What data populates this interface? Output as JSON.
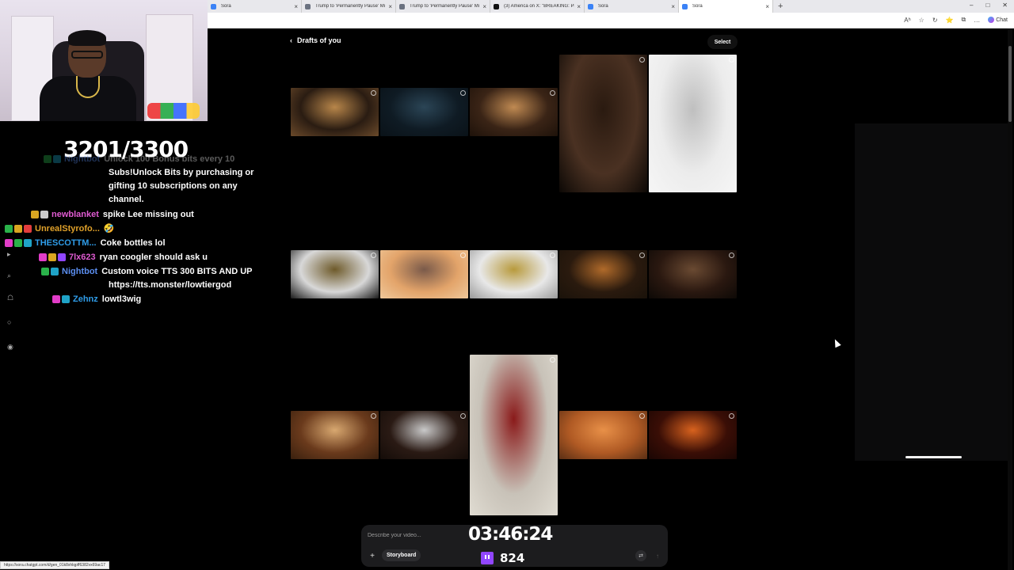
{
  "browser": {
    "tabs": [
      {
        "title": "Sora",
        "fav": "#3b82f6",
        "active": false
      },
      {
        "title": "Trump to 'Permanently Pause' Mi",
        "fav": "#6b7280",
        "active": false
      },
      {
        "title": "Trump to 'Permanently Pause' Mi",
        "fav": "#6b7280",
        "active": false
      },
      {
        "title": "(3) America on X: \"BREAKING: Pre",
        "fav": "#111111",
        "active": false
      },
      {
        "title": "Sora",
        "fav": "#3b82f6",
        "active": false
      },
      {
        "title": "Sora",
        "fav": "#3b82f6",
        "active": true
      }
    ],
    "new_tab_icon": "+",
    "window_controls": [
      "–",
      "□",
      "✕"
    ],
    "toolbar_icons": [
      "Aʰ",
      "☆",
      "↻",
      "⭐",
      "⧉",
      "…"
    ],
    "copilot_label": "Chat",
    "status_url": "https://sora.chatgpt.com/d/gen_01k8xhlqpff6382vx69ac17"
  },
  "stream": {
    "sub_counter": "3201/3300",
    "timer": "03:46:24",
    "viewers": "824"
  },
  "chat": {
    "messages": [
      {
        "user": "Nightbot",
        "color": "#5b8ef0",
        "badges": [
          "#2ab24a",
          "#1fa3c7"
        ],
        "lines": [
          "Unlock 100 Bonus bits every 10",
          "Subs!Unlock Bits by purchasing or",
          "gifting 10 subscriptions on any",
          "channel."
        ]
      },
      {
        "user": "newblanket",
        "color": "#e05bd2",
        "badges": [
          "#d9a621",
          "#cccccc"
        ],
        "lines": [
          "spike Lee missing out"
        ]
      },
      {
        "user": "UnrealStyrofo...",
        "color": "#e0a12a",
        "badges": [
          "#2ab24a",
          "#d9a621",
          "#e23d3d"
        ],
        "lines": [
          "🤣"
        ]
      },
      {
        "user": "THESCOTTM...",
        "color": "#2f9ce8",
        "badges": [
          "#e23dc8",
          "#2ab24a",
          "#1fa3c7"
        ],
        "lines": [
          "Coke bottles lol"
        ]
      },
      {
        "user": "7lx623",
        "color": "#e05bd2",
        "badges": [
          "#e23dc8",
          "#d9a621",
          "#9146ff"
        ],
        "lines": [
          "ryan coogler should ask u"
        ]
      },
      {
        "user": "Nightbot",
        "color": "#5b8ef0",
        "badges": [
          "#2ab24a",
          "#1fa3c7"
        ],
        "lines": [
          "Custom voice TTS 300 BITS AND UP",
          "https://tts.monster/lowtiergod"
        ]
      },
      {
        "user": "Zehnz",
        "color": "#2f9ce8",
        "badges": [
          "#e23dc8",
          "#1fa3c7"
        ],
        "lines": [
          "lowtl3wig"
        ]
      }
    ]
  },
  "sora": {
    "back_label": "Drafts of you",
    "select_label": "Select",
    "thumbnails": [
      {
        "name": "man-smiling-city-lights",
        "colors": [
          "#2a1c12",
          "#b8864a",
          "#6b4a2a"
        ]
      },
      {
        "name": "hand-closeup-blue",
        "colors": [
          "#0f1b24",
          "#2b4556",
          "#0a1218"
        ]
      },
      {
        "name": "dinner-toast-couple",
        "colors": [
          "#3a2416",
          "#c08a52",
          "#1e120a"
        ]
      },
      {
        "name": "smiling-man-gold-chain",
        "colors": [
          "#4a3122",
          "#2a1a10",
          "#0c0805"
        ]
      },
      {
        "name": "glass-pitcher",
        "colors": [
          "#ececec",
          "#bfbfbf",
          "#f6f6f6"
        ]
      },
      {
        "name": "man-gold-robe-mirror",
        "colors": [
          "#d8d8d8",
          "#6e5a2a",
          "#1b1b1b"
        ]
      },
      {
        "name": "couple-sunset",
        "colors": [
          "#e3a46a",
          "#7a5a4a",
          "#f0c89a"
        ]
      },
      {
        "name": "gold-robe-hallway",
        "colors": [
          "#e8e8e8",
          "#b89a3c",
          "#9a9a9a"
        ]
      },
      {
        "name": "woman-bokeh-night",
        "colors": [
          "#2a1a0e",
          "#b06a2a",
          "#1a120a"
        ]
      },
      {
        "name": "man-talking-night",
        "colors": [
          "#2a1810",
          "#6a4a32",
          "#0d0906"
        ]
      },
      {
        "name": "family-dinner-table",
        "colors": [
          "#6a3a1c",
          "#d8a870",
          "#3a200e"
        ]
      },
      {
        "name": "grill-teeth-closeup",
        "colors": [
          "#2a1a14",
          "#c9c9c9",
          "#140c08"
        ]
      },
      {
        "name": "caesar-laurel-wreath",
        "colors": [
          "#c8c2b8",
          "#8a1a1a",
          "#e0dcd2"
        ]
      },
      {
        "name": "robot-arm-orange",
        "colors": [
          "#b05a24",
          "#e89048",
          "#5a2e14"
        ]
      },
      {
        "name": "fire-landscape-figure",
        "colors": [
          "#3a0e06",
          "#d8621e",
          "#1a0603"
        ]
      }
    ]
  },
  "composer": {
    "placeholder": "Describe your video...",
    "add_icon": "+",
    "storyboard_label": "Storyboard",
    "settings_icon": "⇄",
    "send_icon": "↑"
  },
  "rail_icons": [
    "▸",
    "⌕",
    "☖",
    "○",
    "◉"
  ]
}
